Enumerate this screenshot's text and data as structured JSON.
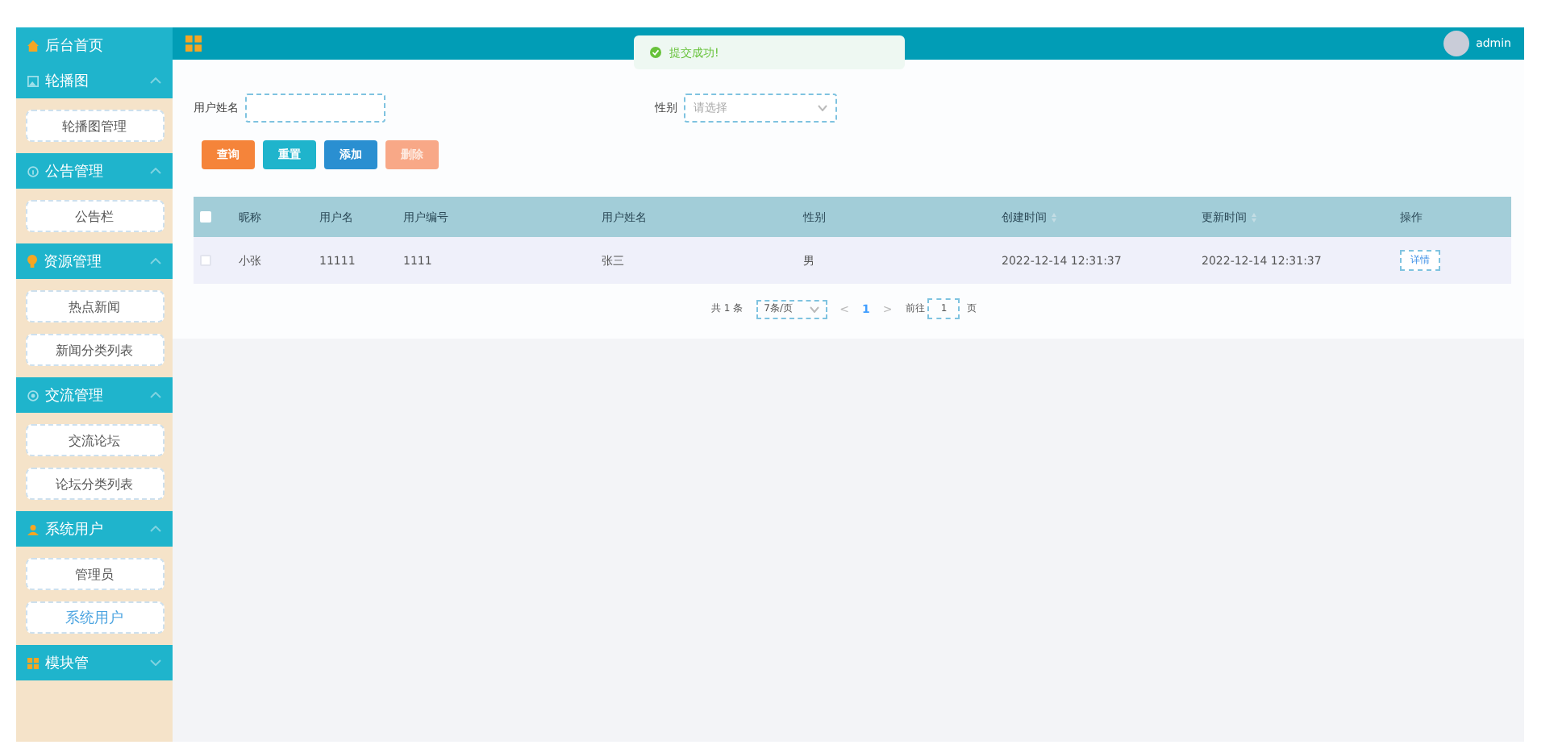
{
  "sidebar": {
    "home": {
      "label": "后台首页"
    },
    "sections": [
      {
        "title": "轮播图",
        "expanded": true,
        "items": [
          {
            "label": "轮播图管理",
            "selected": false
          }
        ]
      },
      {
        "title": "公告管理",
        "expanded": true,
        "items": [
          {
            "label": "公告栏",
            "selected": false
          }
        ]
      },
      {
        "title": "资源管理",
        "expanded": true,
        "items": [
          {
            "label": "热点新闻",
            "selected": false
          },
          {
            "label": "新闻分类列表",
            "selected": false
          }
        ]
      },
      {
        "title": "交流管理",
        "expanded": true,
        "items": [
          {
            "label": "交流论坛",
            "selected": false
          },
          {
            "label": "论坛分类列表",
            "selected": false
          }
        ]
      },
      {
        "title": "系统用户",
        "expanded": true,
        "items": [
          {
            "label": "管理员",
            "selected": false
          },
          {
            "label": "系统用户",
            "selected": true
          }
        ]
      },
      {
        "title": "模块管",
        "expanded": false
      }
    ]
  },
  "header": {
    "user": "admin"
  },
  "toast": {
    "message": "提交成功!"
  },
  "search": {
    "fields": [
      {
        "label": "用户姓名",
        "kind": "input"
      },
      {
        "label": "性别",
        "kind": "select",
        "placeholder": "请选择"
      }
    ],
    "buttons": [
      {
        "label": "查询",
        "color": "#f5843a",
        "disabled": false
      },
      {
        "label": "重置",
        "color": "#1fb4cc",
        "disabled": false
      },
      {
        "label": "添加",
        "color": "#2a8fd1",
        "disabled": false
      },
      {
        "label": "删除",
        "color": "#f8a887",
        "disabled": true
      }
    ]
  },
  "table": {
    "header_checked": false,
    "columns": [
      {
        "label": "昵称",
        "sortable": false
      },
      {
        "label": "用户名",
        "sortable": false
      },
      {
        "label": "用户编号",
        "sortable": false
      },
      {
        "label": "用户姓名",
        "sortable": false
      },
      {
        "label": "性别",
        "sortable": false
      },
      {
        "label": "创建时间",
        "sortable": true
      },
      {
        "label": "更新时间",
        "sortable": true
      },
      {
        "label": "操作",
        "sortable": false
      }
    ],
    "rows": [
      {
        "checked": false,
        "cells": [
          "小张",
          "11111",
          "1111",
          "张三",
          "男",
          "2022-12-14 12:31:37",
          "2022-12-14 12:31:37"
        ],
        "action": "详情"
      }
    ]
  },
  "pagination": {
    "total": "共 1 条",
    "page_size": "7条/页",
    "prev": "<",
    "pages": [
      {
        "label": "1",
        "selected": true
      }
    ],
    "next": ">",
    "goto_label": "前往",
    "goto_value": "1",
    "goto_unit": "页"
  }
}
